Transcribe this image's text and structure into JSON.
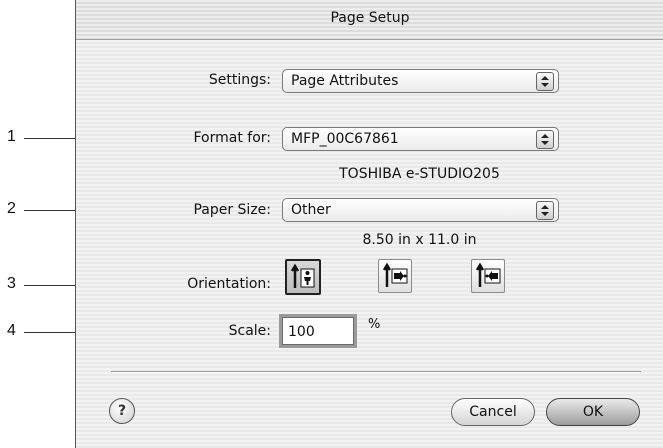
{
  "window": {
    "title": "Page Setup"
  },
  "settings": {
    "label": "Settings:",
    "value": "Page Attributes"
  },
  "format_for": {
    "label": "Format for:",
    "value": "MFP_00C67861",
    "printer_name": "TOSHIBA e-STUDIO205"
  },
  "paper_size": {
    "label": "Paper Size:",
    "value": "Other",
    "dimensions": "8.50 in x 11.0 in"
  },
  "orientation": {
    "label": "Orientation:",
    "options": [
      {
        "icon": "portrait-orientation-icon",
        "selected": true
      },
      {
        "icon": "landscape-left-orientation-icon",
        "selected": false
      },
      {
        "icon": "landscape-right-orientation-icon",
        "selected": false
      }
    ]
  },
  "scale": {
    "label": "Scale:",
    "value": "100",
    "unit": "%"
  },
  "buttons": {
    "help": "?",
    "cancel": "Cancel",
    "ok": "OK"
  },
  "callouts": [
    "1",
    "2",
    "3",
    "4"
  ]
}
